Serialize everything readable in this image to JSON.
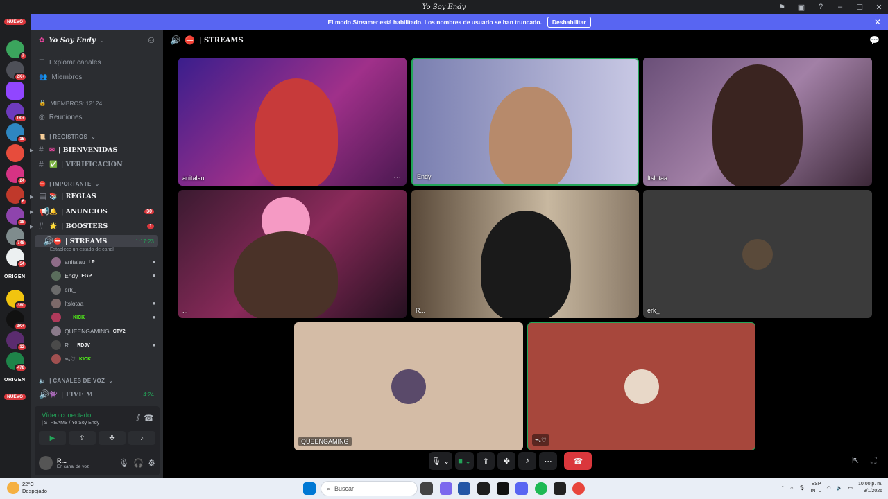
{
  "window": {
    "title": "Yo Soy Endy"
  },
  "banner": {
    "message": "El modo Streamer está habilitado. Los nombres de usuario se han truncado.",
    "button": "Deshabilitar"
  },
  "rail": {
    "nuevo_label": "NUEVO",
    "badges": [
      "365",
      "7",
      "2K+",
      "1K+",
      "15",
      "24",
      "6",
      "18",
      "748",
      "54",
      "382",
      "380",
      "2K+",
      "12",
      "478",
      "48"
    ],
    "origen_label": "ORIGEN"
  },
  "sidebar": {
    "server_name": "Yo Soy Endy",
    "nav": [
      "Explorar canales",
      "Miembros"
    ],
    "members_label": "MIEMBROS: 12124",
    "reuniones": "Reuniones",
    "categories": {
      "registros": "| REGISTROS",
      "importante": "| IMPORTANTE",
      "canales_voz": "| CANALES DE VOZ"
    },
    "channels": {
      "bienvenidas": "| BIENVENIDAS",
      "verificacion": "| VERIFICACION",
      "reglas": "| REGLAS",
      "anuncios": "| ANUNCIOS",
      "anuncios_badge": "30",
      "boosters": "| BOOSTERS",
      "boosters_badge": "1",
      "streams": "| STREAMS",
      "streams_timer": "1:17:23",
      "streams_status": "Establece un estado de canal",
      "fivem": "| FIVE M",
      "fivem_timer": "4:24"
    },
    "voice_users": [
      {
        "name": "anitalau",
        "tag": "LP"
      },
      {
        "name": "Endy",
        "tag": "EGP"
      },
      {
        "name": "erk_",
        "tag": ""
      },
      {
        "name": "Itslotaa",
        "tag": ""
      },
      {
        "name": "...",
        "tag": "KICK"
      },
      {
        "name": "QUEENGAMING",
        "tag": "CTV2"
      },
      {
        "name": "R...",
        "tag": "RDJV"
      },
      {
        "name": "ᯓ♡",
        "tag": "KICK"
      }
    ]
  },
  "voice_panel": {
    "status": "Vídeo conectado",
    "location": "| STREAMS / Yo Soy Endy"
  },
  "user_bar": {
    "name": "R...",
    "status": "En canal de voz"
  },
  "main": {
    "channel_name": "| STREAMS"
  },
  "tiles": [
    {
      "label": "anitalau"
    },
    {
      "label": "Endy"
    },
    {
      "label": "Itslotaa"
    },
    {
      "label": "..."
    },
    {
      "label": "R..."
    },
    {
      "label": "erk_"
    },
    {
      "label": "QUEENGAMING"
    },
    {
      "label": "ᯓ♡"
    }
  ],
  "taskbar": {
    "temp": "22°C",
    "weather": "Despejado",
    "search": "Buscar",
    "lang1": "ESP",
    "lang2": "INTL",
    "time": "10:00 p. m.",
    "date": "9/1/2026"
  },
  "colors": {
    "accent": "#5865f2",
    "online": "#23a559",
    "danger": "#da373c"
  }
}
